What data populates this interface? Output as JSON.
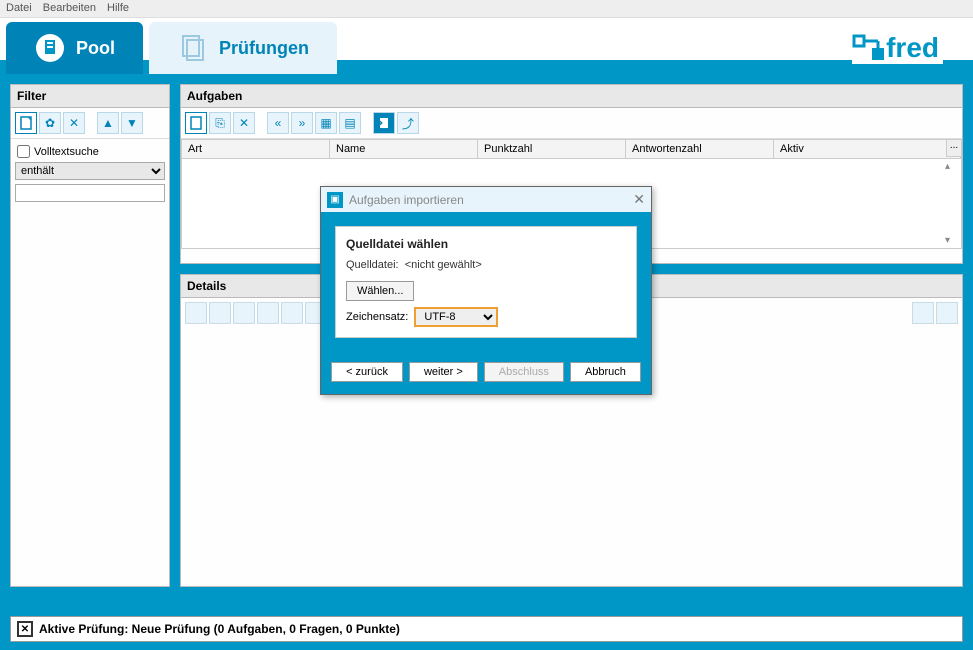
{
  "menu": {
    "file": "Datei",
    "edit": "Bearbeiten",
    "help": "Hilfe"
  },
  "logo_text": "fred",
  "tabs": {
    "pool": "Pool",
    "exams": "Prüfungen"
  },
  "filter": {
    "title": "Filter",
    "fulltext_label": "Volltextsuche",
    "mode_selected": "enthält",
    "search_value": ""
  },
  "aufgaben": {
    "title": "Aufgaben",
    "cols": {
      "art": "Art",
      "name": "Name",
      "punktzahl": "Punktzahl",
      "antwortenzahl": "Antwortenzahl",
      "aktiv": "Aktiv"
    },
    "menu_dots": "..."
  },
  "details": {
    "title": "Details"
  },
  "dialog": {
    "title": "Aufgaben importieren",
    "section": "Quelldatei wählen",
    "file_label": "Quelldatei:",
    "file_value": "<nicht gewählt>",
    "choose_btn": "Wählen...",
    "charset_label": "Zeichensatz:",
    "charset_value": "UTF-8",
    "back": "< zurück",
    "next": "weiter >",
    "finish": "Abschluss",
    "cancel": "Abbruch"
  },
  "status": {
    "text": "Aktive Prüfung: Neue Prüfung (0 Aufgaben, 0 Fragen, 0 Punkte)"
  }
}
